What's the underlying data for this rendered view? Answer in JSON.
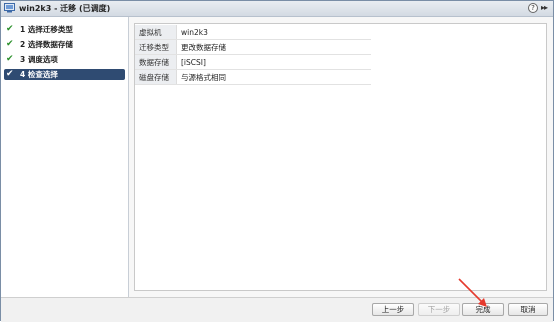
{
  "window": {
    "title": "win2k3 - 迁移 (已调度)",
    "help_glyph": "?",
    "expand_glyph": "▸▸"
  },
  "steps": [
    {
      "check": "✔",
      "label": "1 选择迁移类型",
      "active": false
    },
    {
      "check": "✔",
      "label": "2 选择数据存储",
      "active": false
    },
    {
      "check": "✔",
      "label": "3 调度选项",
      "active": false
    },
    {
      "check": "✔",
      "label": "4 检查选择",
      "active": true
    }
  ],
  "summary": {
    "rows": [
      {
        "key": "虚拟机",
        "value": "win2k3"
      },
      {
        "key": "迁移类型",
        "value": "更改数据存储"
      },
      {
        "key": "数据存储",
        "value": "[iSCSI]"
      },
      {
        "key": "磁盘存储",
        "value": "与源格式相同"
      }
    ]
  },
  "buttons": {
    "back": "上一步",
    "next": "下一步",
    "finish": "完成",
    "cancel": "取消"
  },
  "colors": {
    "active_step": "#2f4b72",
    "check": "#2a8f2a",
    "annotation_arrow": "#e53a2e"
  }
}
